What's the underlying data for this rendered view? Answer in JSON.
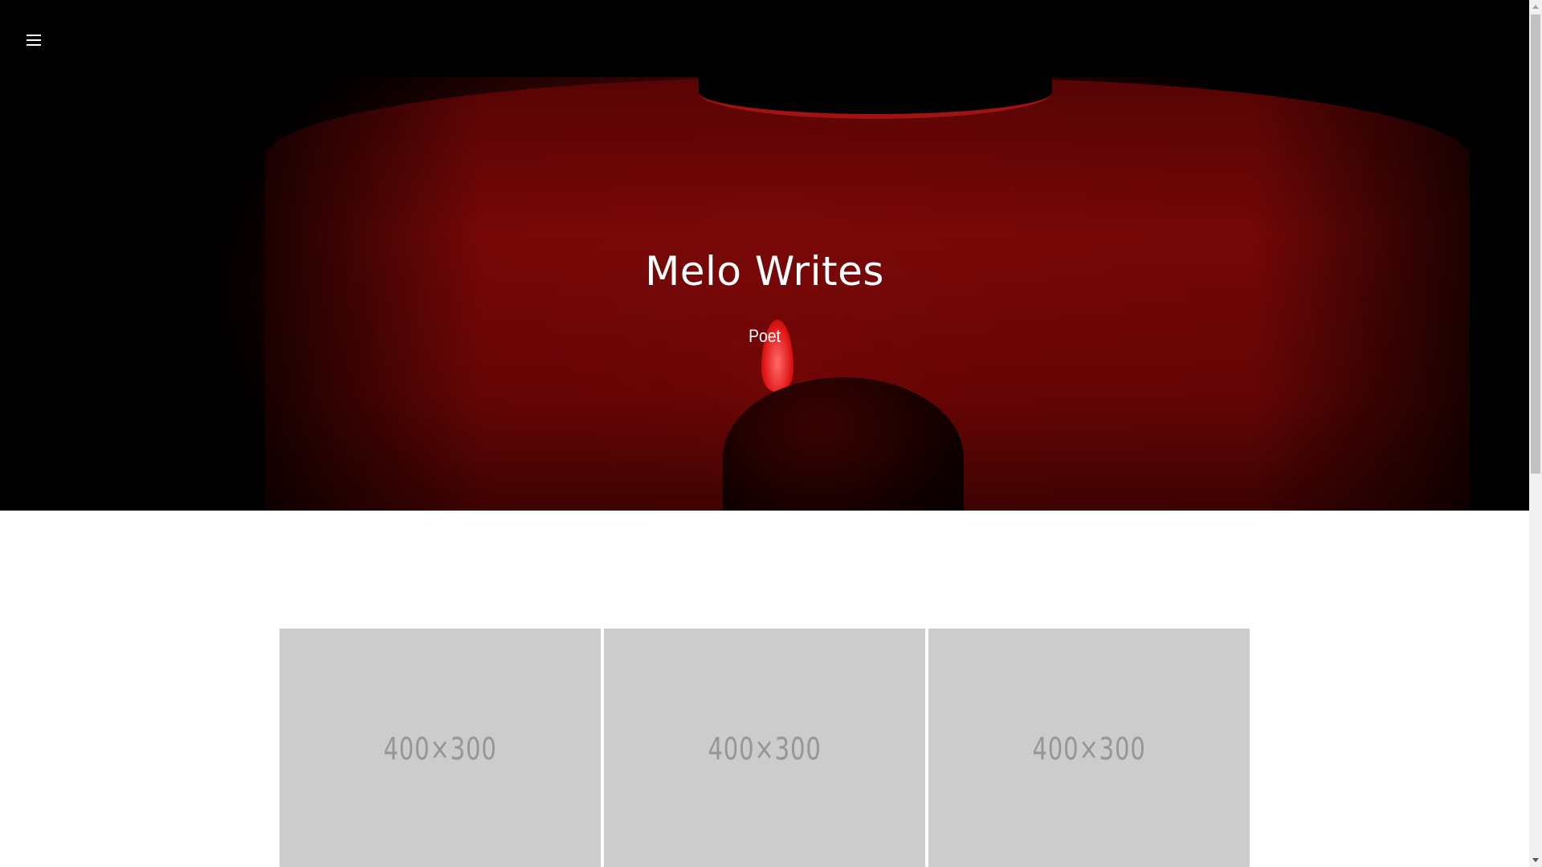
{
  "header": {
    "menu_icon": "hamburger-menu-icon"
  },
  "hero": {
    "title": "Melo Writes",
    "subtitle": "Poet",
    "background_image": "person-holding-red-lighter-in-dark"
  },
  "gallery": {
    "items": [
      {
        "label": "400×300"
      },
      {
        "label": "400×300"
      },
      {
        "label": "400×300"
      }
    ]
  },
  "colors": {
    "topbar": "#000000",
    "hero_red": "#7a0808",
    "thumb_bg": "#cccccc",
    "thumb_text": "#969696",
    "text_light": "#ffffff"
  }
}
